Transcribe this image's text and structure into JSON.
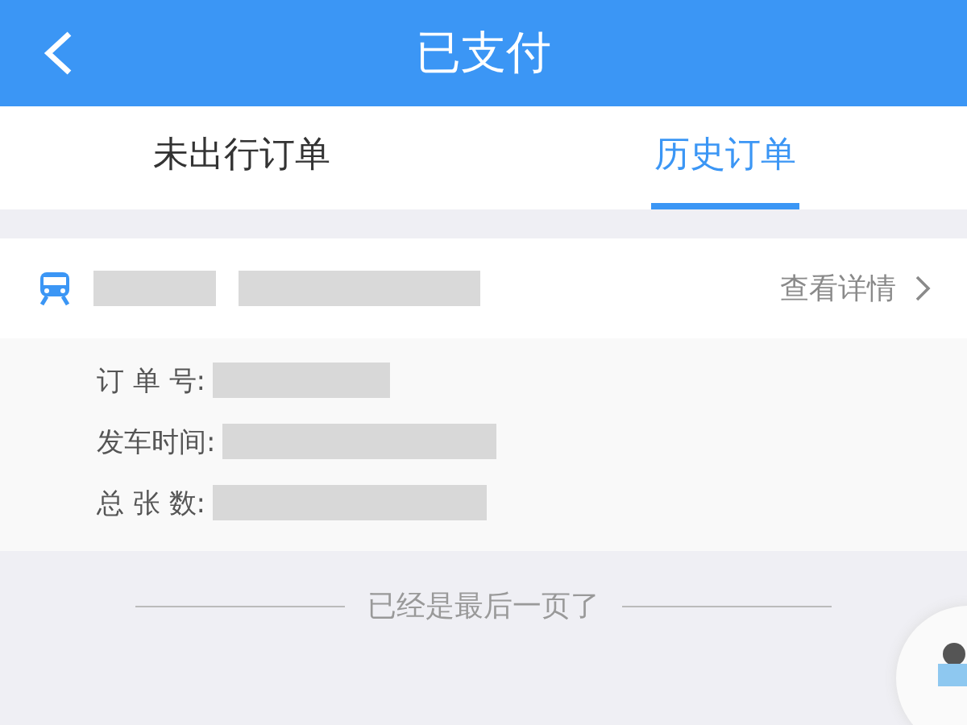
{
  "header": {
    "title": "已支付"
  },
  "tabs": [
    {
      "label": "未出行订单",
      "selected": false
    },
    {
      "label": "历史订单",
      "selected": true
    }
  ],
  "order": {
    "detail_link": "查看详情",
    "fields": [
      {
        "label": "订 单 号:"
      },
      {
        "label": "发车时间:"
      },
      {
        "label": "总 张 数:"
      }
    ]
  },
  "footer": {
    "text": "已经是最后一页了"
  }
}
